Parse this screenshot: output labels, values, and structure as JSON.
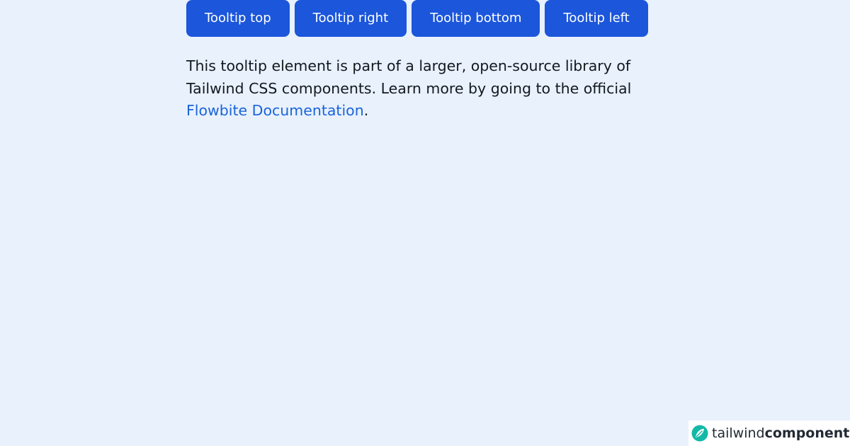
{
  "buttons": [
    {
      "label": "Tooltip top"
    },
    {
      "label": "Tooltip right"
    },
    {
      "label": "Tooltip bottom"
    },
    {
      "label": "Tooltip left"
    }
  ],
  "description": {
    "text": "This tooltip element is part of a larger, open-source library of Tailwind CSS components. Learn more by going to the official ",
    "link_text": "Flowbite Documentation",
    "suffix": "."
  },
  "brand": {
    "light": "tailwind",
    "bold": "components",
    "logo_icon": "leaf-icon"
  },
  "colors": {
    "background": "#e8f1fc",
    "button": "#1b56db",
    "link": "#1b63da",
    "brand_accent": "#14b8a6"
  }
}
